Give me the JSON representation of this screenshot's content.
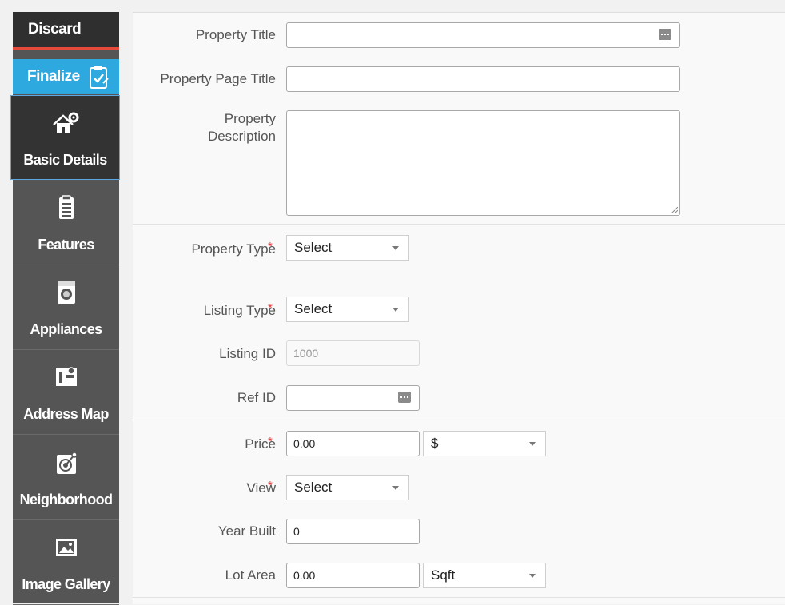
{
  "sidebar": {
    "discard_label": "Discard",
    "finalize_label": "Finalize",
    "items": [
      {
        "label": "Basic Details",
        "icon": "house-gear-icon"
      },
      {
        "label": "Features",
        "icon": "clipboard-icon"
      },
      {
        "label": "Appliances",
        "icon": "washing-machine-icon"
      },
      {
        "label": "Address Map",
        "icon": "map-icon"
      },
      {
        "label": "Neighborhood",
        "icon": "target-icon"
      },
      {
        "label": "Image Gallery",
        "icon": "image-icon"
      }
    ]
  },
  "form": {
    "property_title": {
      "label": "Property Title",
      "value": ""
    },
    "property_page_title": {
      "label": "Property Page Title",
      "value": ""
    },
    "property_description": {
      "label_line1": "Property",
      "label_line2": "Description",
      "value": ""
    },
    "property_type": {
      "label": "Property Type",
      "value": "Select",
      "required": "*"
    },
    "listing_type": {
      "label": "Listing Type",
      "value": "Select",
      "required": "*"
    },
    "listing_id": {
      "label": "Listing ID",
      "placeholder": "1000"
    },
    "ref_id": {
      "label": "Ref ID",
      "value": ""
    },
    "price": {
      "label": "Price",
      "value": "0.00",
      "currency": "$",
      "required": "*"
    },
    "view": {
      "label": "View",
      "value": "Select",
      "required": "*"
    },
    "year_built": {
      "label": "Year Built",
      "value": "0"
    },
    "lot_area": {
      "label": "Lot Area",
      "value": "0.00",
      "unit": "Sqft"
    }
  },
  "colors": {
    "sidebar_bg": "#555555",
    "active_bg": "#333333",
    "finalize_bg": "#2ea9e0",
    "discard_accent": "#e74a3b",
    "required": "#e53935"
  }
}
